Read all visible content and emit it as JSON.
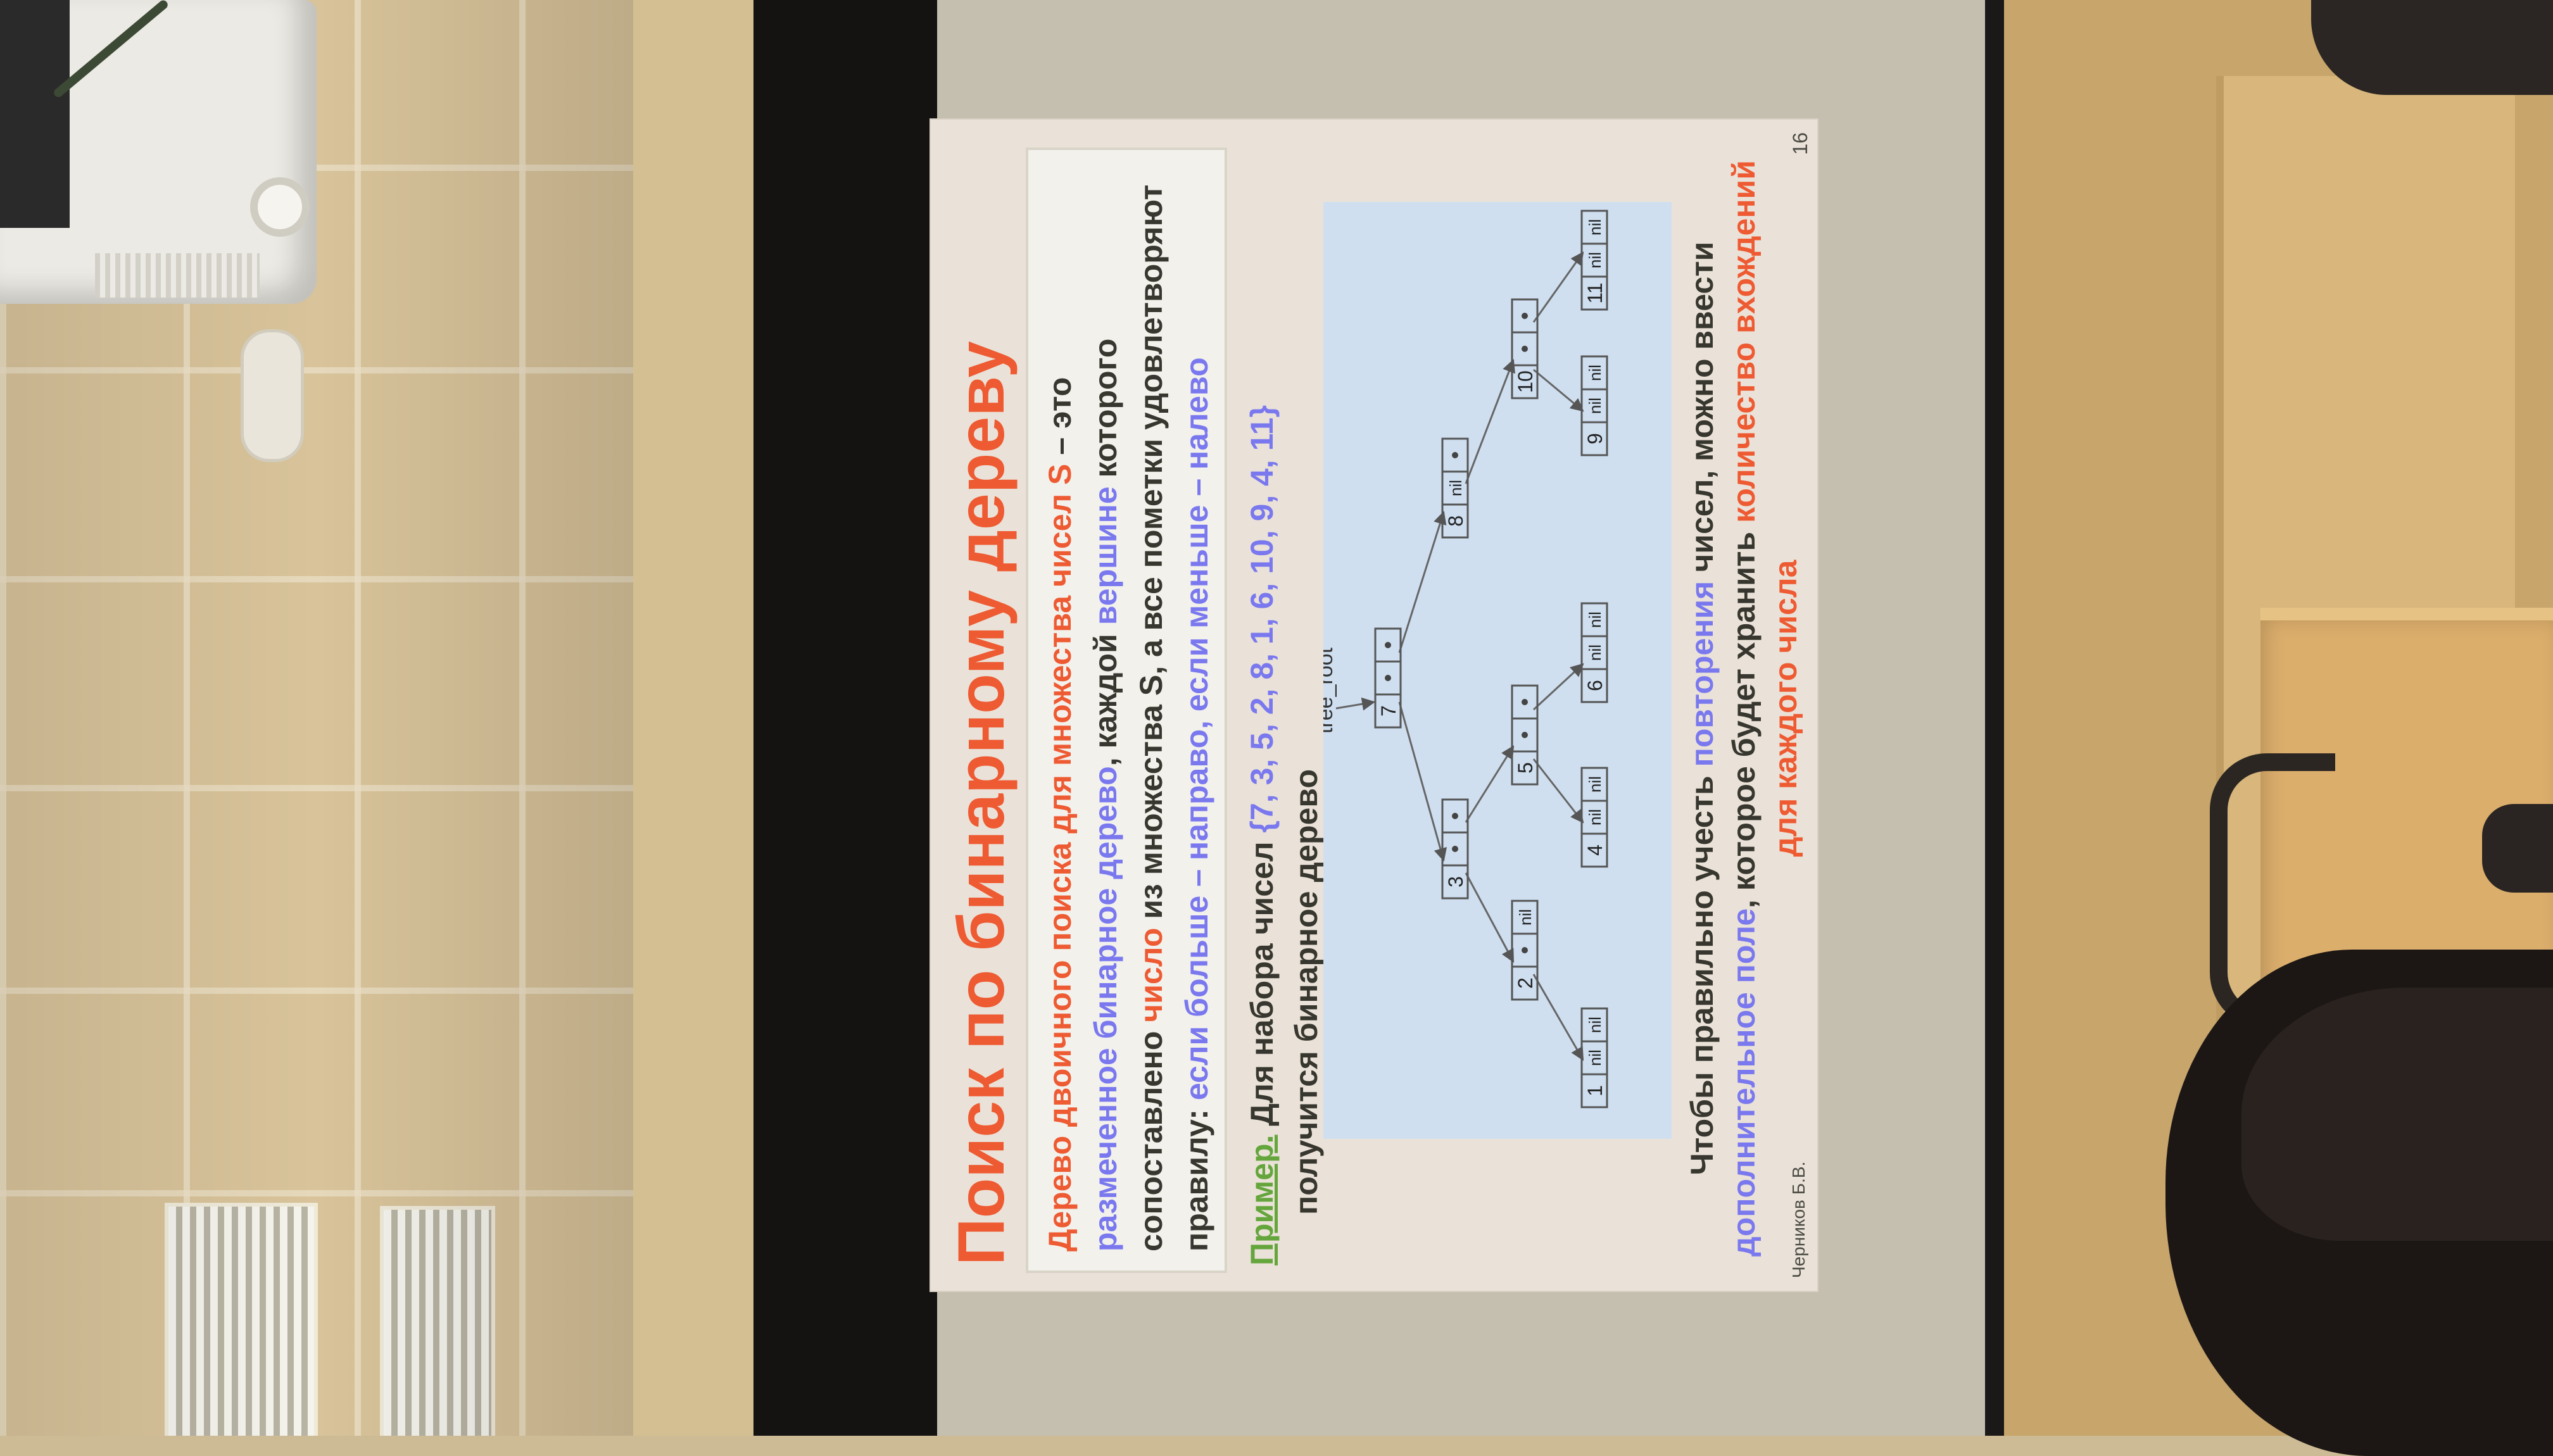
{
  "slide": {
    "title": "Поиск по бинарному дереву",
    "definition": {
      "p1": "Дерево двоичного поиска для множества чисел S",
      "p2": " – это ",
      "p3": "размеченное бинарное дерево",
      "p4": ", каждой ",
      "p5": "вершине",
      "p6": " которого сопоставлено ",
      "p7": "число",
      "p8": " из множества S, а все пометки удовлетворяют правилу: ",
      "p9": "если больше – направо, если меньше – налево"
    },
    "example": {
      "label": "Пример.",
      "text1": " Для набора чисел ",
      "set": "{7, 3, 5, 2, 8, 1, 6, 10, 9, 4, 11}",
      "text2": "получится бинарное дерево"
    },
    "tree": {
      "root_label": "tree_root",
      "nil": "nil",
      "nodes": [
        "7",
        "3",
        "8",
        "2",
        "5",
        "10",
        "1",
        "4",
        "6",
        "9",
        "11"
      ]
    },
    "footer": {
      "p1": "Чтобы правильно учесть ",
      "p2": "повторения",
      "p3": " чисел, можно ввести ",
      "p4": "дополнительное поле",
      "p5": ", которое будет хранить ",
      "p6": "количество вхождений для каждого числа"
    },
    "author": "Черников Б.В.",
    "page_number": "16"
  }
}
